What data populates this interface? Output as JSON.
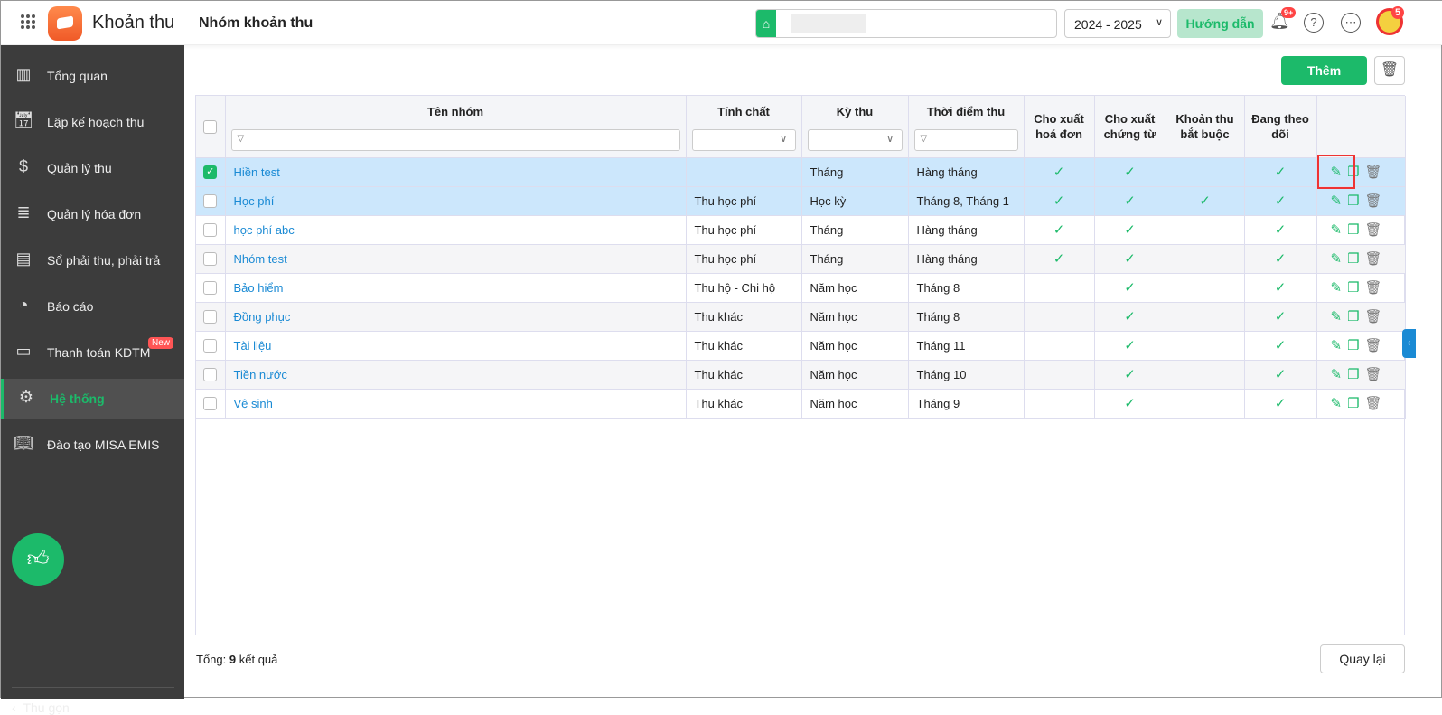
{
  "header": {
    "app_title": "Khoản thu",
    "page_title": "Nhóm khoản thu",
    "school_year": "2024 - 2025",
    "guide_label": "Hướng dẫn",
    "notif_badge": "9+",
    "avatar_badge": "5"
  },
  "sidebar": {
    "items": [
      {
        "label": "Tổng quan",
        "icon": "chart-icon"
      },
      {
        "label": "Lập kế hoạch thu",
        "icon": "calendar-dollar-icon"
      },
      {
        "label": "Quản lý thu",
        "icon": "money-hand-icon"
      },
      {
        "label": "Quản lý hóa đơn",
        "icon": "invoice-icon"
      },
      {
        "label": "Sổ phải thu, phải trả",
        "icon": "ledger-icon"
      },
      {
        "label": "Báo cáo",
        "icon": "pie-chart-icon"
      },
      {
        "label": "Thanh toán KDTM",
        "icon": "card-icon",
        "badge": "New"
      },
      {
        "label": "Hệ thống",
        "icon": "gear-icon",
        "active": true
      },
      {
        "label": "Đào tạo MISA EMIS",
        "icon": "book-icon"
      }
    ],
    "collapse_label": "Thu gọn"
  },
  "toolbar": {
    "add_label": "Thêm"
  },
  "table": {
    "columns": [
      "Tên nhóm",
      "Tính chất",
      "Kỳ thu",
      "Thời điểm thu",
      "Cho xuất hoá đơn",
      "Cho xuất chứng từ",
      "Khoản thu bắt buộc",
      "Đang theo dõi"
    ],
    "rows": [
      [
        "Hiền test",
        "",
        "Tháng",
        "Hàng tháng",
        1,
        1,
        0,
        1
      ],
      [
        "Học phí",
        "Thu học phí",
        "Học kỳ",
        "Tháng 8, Tháng 1",
        1,
        1,
        1,
        1
      ],
      [
        "học phí abc",
        "Thu học phí",
        "Tháng",
        "Hàng tháng",
        1,
        1,
        0,
        1
      ],
      [
        "Nhóm test",
        "Thu học phí",
        "Tháng",
        "Hàng tháng",
        1,
        1,
        0,
        1
      ],
      [
        "Bảo hiểm",
        "Thu hộ - Chi hộ",
        "Năm học",
        "Tháng 8",
        0,
        1,
        0,
        1
      ],
      [
        "Đồng phục",
        "Thu khác",
        "Năm học",
        "Tháng 8",
        0,
        1,
        0,
        1
      ],
      [
        "Tài liệu",
        "Thu khác",
        "Năm học",
        "Tháng 11",
        0,
        1,
        0,
        1
      ],
      [
        "Tiền nước",
        "Thu khác",
        "Năm học",
        "Tháng 10",
        0,
        1,
        0,
        1
      ],
      [
        "Vệ sinh",
        "Thu khác",
        "Năm học",
        "Tháng 9",
        0,
        1,
        0,
        1
      ]
    ]
  },
  "footer": {
    "total_prefix": "Tổng:",
    "total_count": "9",
    "total_suffix": "kết quả",
    "back_label": "Quay lại"
  }
}
